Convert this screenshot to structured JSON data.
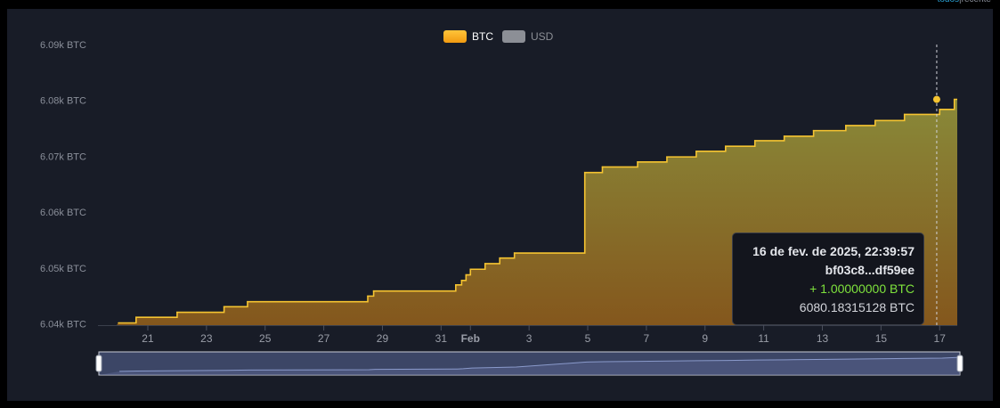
{
  "header": {
    "link_all": "todos",
    "separator": "|",
    "link_recent": "recente"
  },
  "legend": [
    {
      "label": "BTC",
      "color": "#f6a623"
    },
    {
      "label": "USD",
      "color": "#8c8f96"
    }
  ],
  "tooltip": {
    "date": "16 de fev. de 2025, 22:39:57",
    "tx": "bf03c8...df59ee",
    "change": "+ 1.00000000 BTC",
    "balance": "6080.18315128 BTC"
  },
  "colors": {
    "line": "#f5c431",
    "area_top": "#8f8f3a",
    "area_bottom": "#8a5a1c",
    "background": "#181c27",
    "navigator_fill": "#3c4666"
  },
  "chart_data": {
    "type": "area",
    "step": true,
    "title": "",
    "xlabel": "",
    "ylabel": "",
    "series": [
      {
        "name": "BTC",
        "x": [
          20.0,
          20.6,
          22.0,
          23.6,
          24.4,
          28.5,
          28.7,
          31.5,
          31.7,
          31.85,
          32.0,
          32.5,
          33.0,
          33.5,
          35.9,
          36.5,
          37.7,
          38.7,
          39.7,
          40.7,
          41.7,
          42.7,
          43.7,
          44.8,
          45.8,
          46.8,
          48.0
        ],
        "values": [
          6040.2,
          6041.2,
          6042.1,
          6043.1,
          6044.0,
          6045.0,
          6045.9,
          6047.0,
          6047.8,
          6048.8,
          6049.8,
          6050.8,
          6051.8,
          6052.7,
          6067.1,
          6068.1,
          6069.0,
          6069.9,
          6070.9,
          6071.8,
          6072.8,
          6073.6,
          6074.6,
          6075.5,
          6076.4,
          6077.5,
          6078.4
        ]
      }
    ],
    "last_point": {
      "x": 48.5,
      "value": 6080.2
    },
    "highlight": {
      "x": 47.9,
      "value": 6080.18315128
    },
    "xlim": [
      19.3,
      48.6
    ],
    "ylim": [
      6039.8,
      6090.0
    ],
    "yticks": [
      6040,
      6050,
      6060,
      6070,
      6080,
      6090
    ],
    "ytick_labels": [
      "6.04k BTC",
      "6.05k BTC",
      "6.06k BTC",
      "6.07k BTC",
      "6.08k BTC",
      "6.09k BTC"
    ],
    "xticks": [
      21,
      23,
      25,
      27,
      29,
      31,
      32,
      34,
      36,
      38,
      40,
      42,
      44,
      46,
      48
    ],
    "xtick_labels": [
      "21",
      "23",
      "25",
      "27",
      "29",
      "31",
      "Feb",
      "3",
      "5",
      "7",
      "9",
      "11",
      "13",
      "15",
      "17"
    ],
    "grid": false,
    "legend_position": "top-center"
  }
}
